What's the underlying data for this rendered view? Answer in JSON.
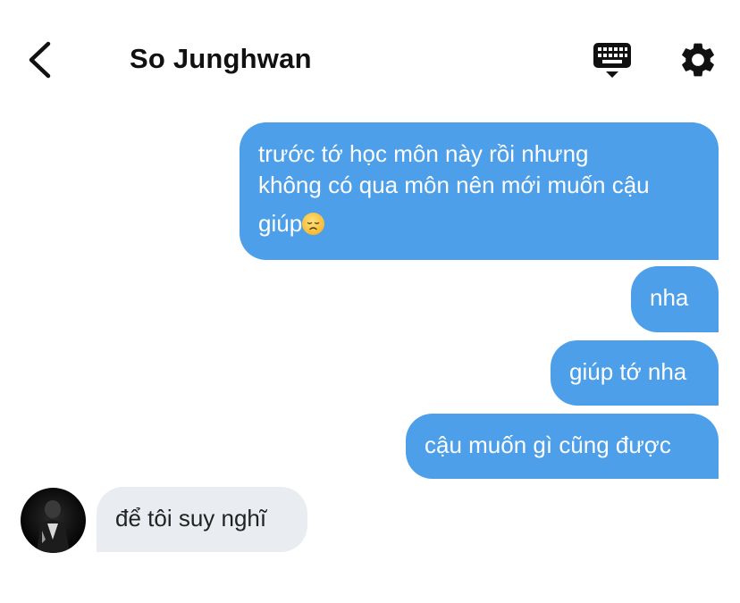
{
  "header": {
    "title": "So Junghwan",
    "back_icon": "chevron-left-icon",
    "keyboard_icon": "keyboard-icon",
    "settings_icon": "gear-icon"
  },
  "messages": [
    {
      "direction": "outgoing",
      "lines": [
        "trước tớ học môn này rồi nhưng",
        "không có qua môn nên mới muốn cậu",
        "giúp"
      ],
      "emoji": "disappointed-face-emoji"
    },
    {
      "direction": "outgoing",
      "text": "nha"
    },
    {
      "direction": "outgoing",
      "text": "giúp tớ nha"
    },
    {
      "direction": "outgoing",
      "text": "cậu muốn gì cũng được"
    },
    {
      "direction": "incoming",
      "text": "để tôi suy nghĩ",
      "avatar": "contact-avatar"
    }
  ],
  "colors": {
    "outgoing_bubble": "#4c9fe8",
    "incoming_bubble": "#e9edf1",
    "title_text": "#111111"
  }
}
